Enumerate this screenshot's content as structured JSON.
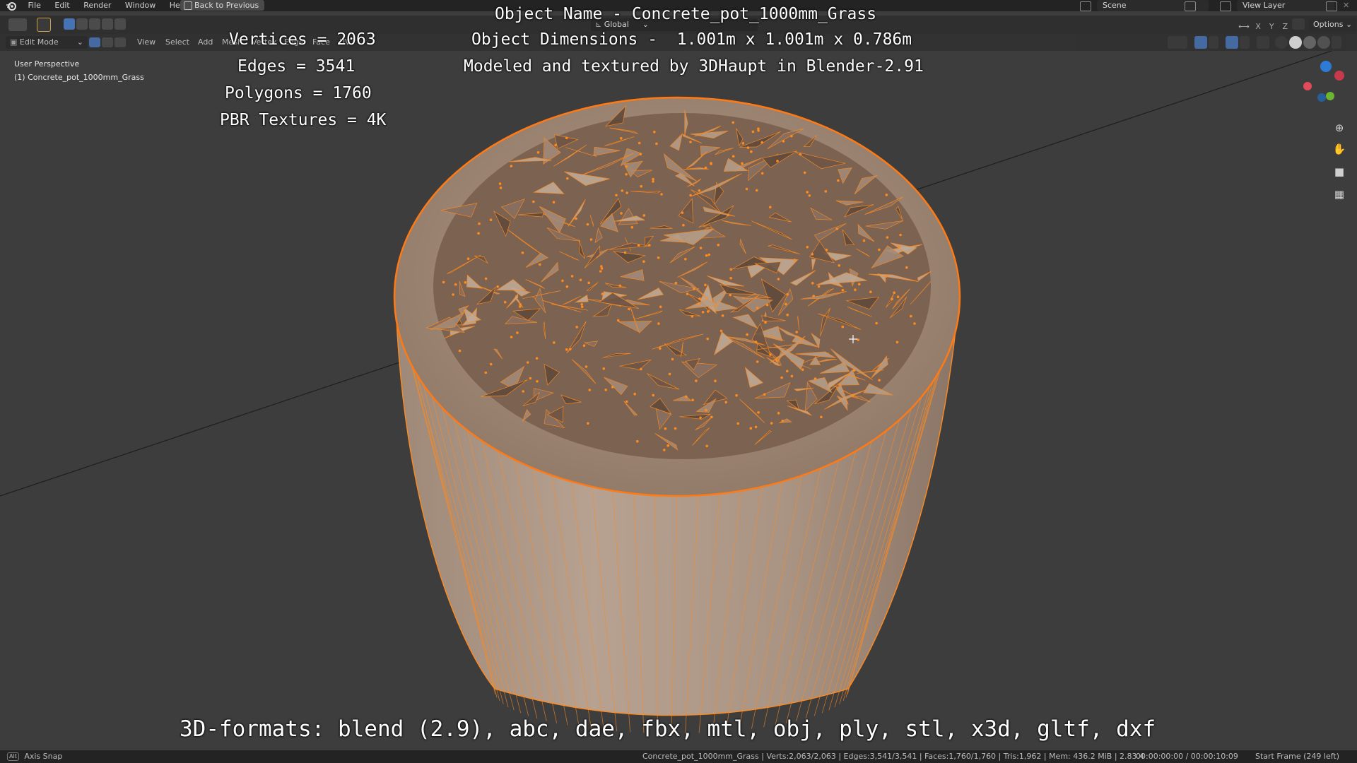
{
  "menu": {
    "items": [
      "File",
      "Edit",
      "Render",
      "Window",
      "Help"
    ],
    "back_button": "Back to Previous"
  },
  "topright": {
    "scene": "Scene",
    "view_layer": "View Layer"
  },
  "header": {
    "mode": "Edit Mode",
    "menus": [
      "View",
      "Select",
      "Add",
      "Mesh",
      "Vertex",
      "Edge",
      "Face",
      "UV"
    ],
    "transform_orientation": "Global",
    "axes": [
      "X",
      "Y",
      "Z"
    ],
    "options": "Options"
  },
  "viewport": {
    "perspective_label": "User Perspective",
    "object_label": "(1) Concrete_pot_1000mm_Grass"
  },
  "overlay": {
    "vertices": "Vertices = 2063",
    "edges": "Edges = 3541",
    "polygons": "Polygons = 1760",
    "textures": "PBR Textures = 4K",
    "object_name": "Object Name - Concrete_pot_1000mm_Grass",
    "object_dimensions": "Object Dimensions -  1.001m x 1.001m x 0.786m",
    "credits": "Modeled and textured by 3DHaupt in Blender-2.91",
    "formats": "3D-formats: blend (2.9), abc, dae, fbx, mtl, obj, ply, stl, x3d, gltf, dxf"
  },
  "statusbar": {
    "key": "Alt",
    "axis_snap": "Axis Snap",
    "stats": "Concrete_pot_1000mm_Grass | Verts:2,063/2,063 | Edges:3,541/3,541 | Faces:1,760/1,760 | Tris:1,962 | Mem: 436.2 MiB | 2.83.4",
    "time": "00:00:00:00 / 00:00:10:09",
    "frame": "Start Frame (249 left)"
  },
  "colors": {
    "wire": "#ff8a1e",
    "mesh": "#b39a86",
    "background": "#3d3d3d",
    "accent": "#4772b3"
  }
}
